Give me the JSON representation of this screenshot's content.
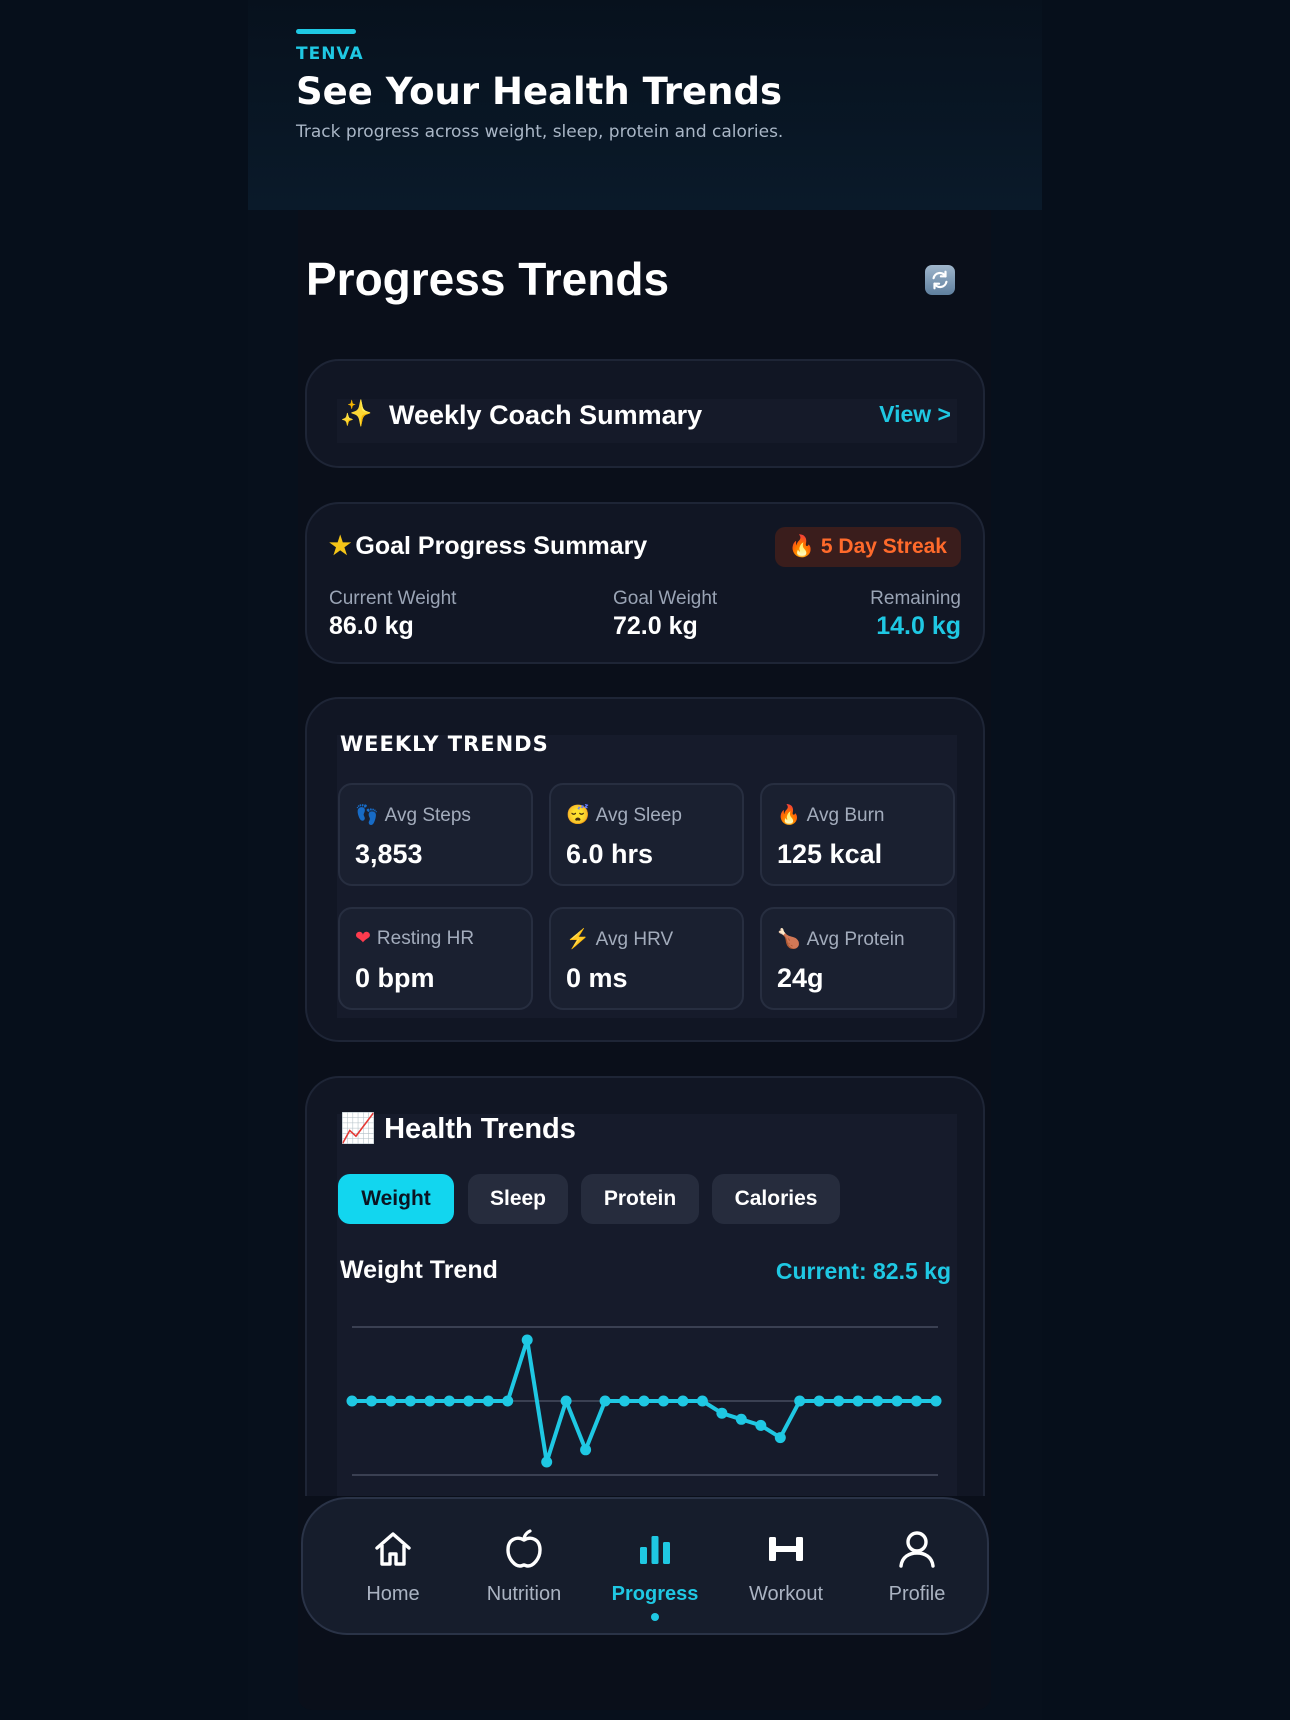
{
  "hero": {
    "brand": "TENVA",
    "title": "See Your Health Trends",
    "subtitle": "Track progress across weight, sleep, protein and calories."
  },
  "screen": {
    "title": "Progress Trends",
    "refresh_icon": "refresh-icon"
  },
  "coach": {
    "icon": "sparkles-icon",
    "label": "Weekly Coach Summary",
    "link": "View >"
  },
  "goal": {
    "title": "Goal Progress Summary",
    "icon": "star-icon",
    "streak": "5 Day Streak",
    "streak_icon": "fire-icon",
    "stats": [
      {
        "label": "Current Weight",
        "value": "86.0 kg"
      },
      {
        "label": "Goal Weight",
        "value": "72.0 kg"
      },
      {
        "label": "Remaining",
        "value": "14.0 kg"
      }
    ]
  },
  "weekly": {
    "title": "WEEKLY TRENDS",
    "tiles": [
      {
        "icon": "footprints-icon",
        "glyph": "👣",
        "label": "Avg Steps",
        "value": "3,853"
      },
      {
        "icon": "sleeping-face-icon",
        "glyph": "😴",
        "label": "Avg Sleep",
        "value": "6.0 hrs"
      },
      {
        "icon": "fire-icon",
        "glyph": "🔥",
        "label": "Avg Burn",
        "value": "125 kcal"
      },
      {
        "icon": "heart-icon",
        "glyph": "❤",
        "label": "Resting HR",
        "value": "0 bpm"
      },
      {
        "icon": "lightning-icon",
        "glyph": "⚡",
        "label": "Avg HRV",
        "value": "0 ms"
      },
      {
        "icon": "drumstick-icon",
        "glyph": "🍗",
        "label": "Avg Protein",
        "value": "24g"
      }
    ]
  },
  "health": {
    "title": "Health Trends",
    "icon": "chart-increasing-icon",
    "tabs": [
      "Weight",
      "Sleep",
      "Protein",
      "Calories"
    ],
    "active_tab": "Weight",
    "trend_label": "Weight Trend",
    "current": "Current: 82.5 kg"
  },
  "chart_data": {
    "type": "line",
    "title": "Weight Trend",
    "series": [
      {
        "values": [
          86,
          86,
          86,
          86,
          86,
          86,
          86,
          86,
          86,
          91,
          81,
          86,
          82,
          86,
          86,
          86,
          86,
          86,
          86,
          85,
          84.5,
          84,
          83,
          86,
          86,
          86,
          86,
          86,
          86,
          86,
          86
        ]
      }
    ],
    "grid": true,
    "color": "#1fc8e3"
  },
  "nav": {
    "items": [
      {
        "label": "Home",
        "icon": "home-icon"
      },
      {
        "label": "Nutrition",
        "icon": "apple-icon"
      },
      {
        "label": "Progress",
        "icon": "bar-chart-icon"
      },
      {
        "label": "Workout",
        "icon": "dumbbell-icon"
      },
      {
        "label": "Profile",
        "icon": "user-icon"
      }
    ],
    "active": "Progress"
  },
  "colors": {
    "accent": "#1fc8e3",
    "streak": "#ff6a2b",
    "background": "#0a0f1a"
  }
}
